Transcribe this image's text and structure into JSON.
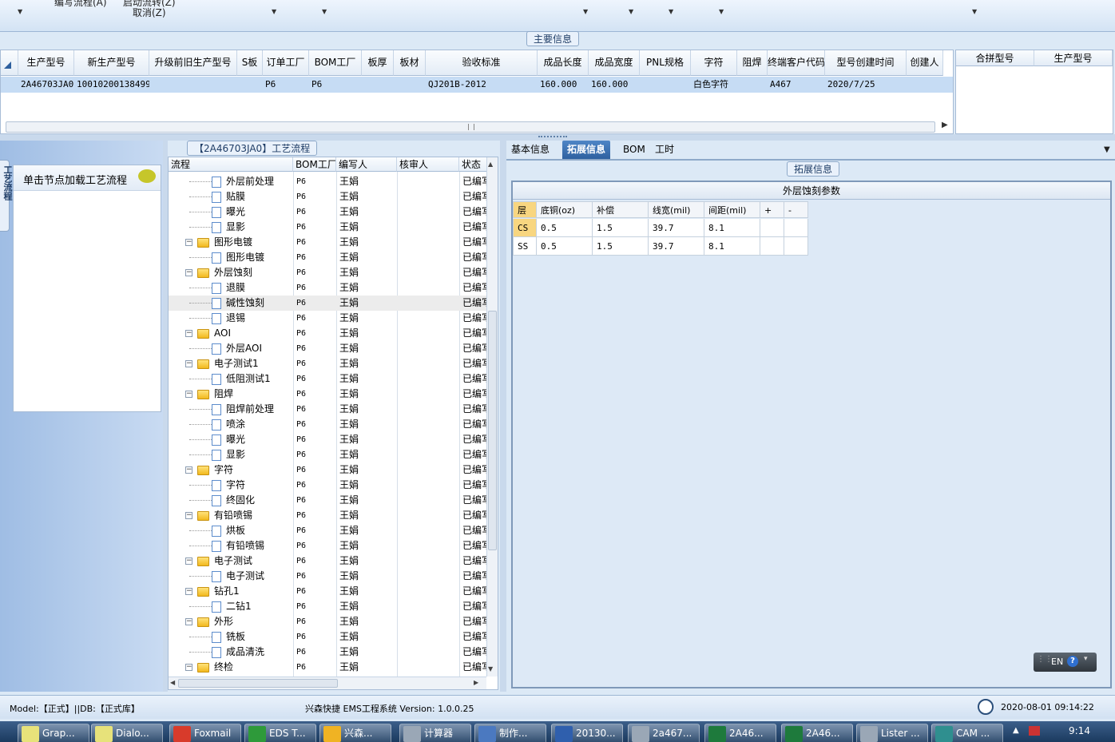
{
  "toolbar": {
    "partial1": "编写流程(A)",
    "partial2": "启动流转(Z)",
    "cancel": "取消(Z)"
  },
  "main_info": {
    "section_title": "主要信息",
    "columns": [
      "生产型号",
      "新生产型号",
      "升级前旧生产型号",
      "S板",
      "订单工厂",
      "BOM工厂",
      "板厚",
      "板材",
      "验收标准",
      "成品长度",
      "成品宽度",
      "PNL规格",
      "字符",
      "阻焊",
      "终端客户代码",
      "型号创建时间",
      "创建人"
    ],
    "row": [
      "2A46703JA0",
      "10010200138499",
      "",
      "",
      "P6",
      "P6",
      "",
      "",
      "QJ201B-2012",
      "160.000",
      "160.000",
      "",
      "白色字符",
      "",
      "A467",
      "2020/7/25",
      ""
    ]
  },
  "merge_panel": {
    "columns": [
      "合拼型号",
      "生产型号"
    ]
  },
  "left_panel": {
    "side_tab": "工艺流程",
    "node_hint": "单击节点加载工艺流程"
  },
  "process_tree": {
    "title": "【2A46703JA0】工艺流程",
    "columns": [
      "流程",
      "BOM工厂",
      "编写人",
      "核审人",
      "状态"
    ],
    "rows": [
      {
        "name": "外层前处理",
        "folder": false,
        "factory": "P6",
        "author": "王娟",
        "reviewer": "",
        "status": "已编写"
      },
      {
        "name": "贴膜",
        "folder": false,
        "factory": "P6",
        "author": "王娟",
        "reviewer": "",
        "status": "已编写"
      },
      {
        "name": "曝光",
        "folder": false,
        "factory": "P6",
        "author": "王娟",
        "reviewer": "",
        "status": "已编写"
      },
      {
        "name": "显影",
        "folder": false,
        "factory": "P6",
        "author": "王娟",
        "reviewer": "",
        "status": "已编写"
      },
      {
        "name": "图形电镀",
        "folder": true,
        "factory": "P6",
        "author": "王娟",
        "reviewer": "",
        "status": "已编写"
      },
      {
        "name": "图形电镀",
        "folder": false,
        "factory": "P6",
        "author": "王娟",
        "reviewer": "",
        "status": "已编写"
      },
      {
        "name": "外层蚀刻",
        "folder": true,
        "factory": "P6",
        "author": "王娟",
        "reviewer": "",
        "status": "已编写"
      },
      {
        "name": "退膜",
        "folder": false,
        "factory": "P6",
        "author": "王娟",
        "reviewer": "",
        "status": "已编写"
      },
      {
        "name": "碱性蚀刻",
        "folder": false,
        "factory": "P6",
        "author": "王娟",
        "reviewer": "",
        "status": "已编写",
        "selected": true
      },
      {
        "name": "退锡",
        "folder": false,
        "factory": "P6",
        "author": "王娟",
        "reviewer": "",
        "status": "已编写"
      },
      {
        "name": "AOI",
        "folder": true,
        "factory": "P6",
        "author": "王娟",
        "reviewer": "",
        "status": "已编写"
      },
      {
        "name": "外层AOI",
        "folder": false,
        "factory": "P6",
        "author": "王娟",
        "reviewer": "",
        "status": "已编写"
      },
      {
        "name": "电子测试1",
        "folder": true,
        "factory": "P6",
        "author": "王娟",
        "reviewer": "",
        "status": "已编写"
      },
      {
        "name": "低阻测试1",
        "folder": false,
        "factory": "P6",
        "author": "王娟",
        "reviewer": "",
        "status": "已编写"
      },
      {
        "name": "阻焊",
        "folder": true,
        "factory": "P6",
        "author": "王娟",
        "reviewer": "",
        "status": "已编写"
      },
      {
        "name": "阻焊前处理",
        "folder": false,
        "factory": "P6",
        "author": "王娟",
        "reviewer": "",
        "status": "已编写"
      },
      {
        "name": "喷涂",
        "folder": false,
        "factory": "P6",
        "author": "王娟",
        "reviewer": "",
        "status": "已编写"
      },
      {
        "name": "曝光",
        "folder": false,
        "factory": "P6",
        "author": "王娟",
        "reviewer": "",
        "status": "已编写"
      },
      {
        "name": "显影",
        "folder": false,
        "factory": "P6",
        "author": "王娟",
        "reviewer": "",
        "status": "已编写"
      },
      {
        "name": "字符",
        "folder": true,
        "factory": "P6",
        "author": "王娟",
        "reviewer": "",
        "status": "已编写"
      },
      {
        "name": "字符",
        "folder": false,
        "factory": "P6",
        "author": "王娟",
        "reviewer": "",
        "status": "已编写"
      },
      {
        "name": "终固化",
        "folder": false,
        "factory": "P6",
        "author": "王娟",
        "reviewer": "",
        "status": "已编写"
      },
      {
        "name": "有铅喷锡",
        "folder": true,
        "factory": "P6",
        "author": "王娟",
        "reviewer": "",
        "status": "已编写"
      },
      {
        "name": "烘板",
        "folder": false,
        "factory": "P6",
        "author": "王娟",
        "reviewer": "",
        "status": "已编写"
      },
      {
        "name": "有铅喷锡",
        "folder": false,
        "factory": "P6",
        "author": "王娟",
        "reviewer": "",
        "status": "已编写"
      },
      {
        "name": "电子测试",
        "folder": true,
        "factory": "P6",
        "author": "王娟",
        "reviewer": "",
        "status": "已编写"
      },
      {
        "name": "电子测试",
        "folder": false,
        "factory": "P6",
        "author": "王娟",
        "reviewer": "",
        "status": "已编写"
      },
      {
        "name": "钻孔1",
        "folder": true,
        "factory": "P6",
        "author": "王娟",
        "reviewer": "",
        "status": "已编写"
      },
      {
        "name": "二钻1",
        "folder": false,
        "factory": "P6",
        "author": "王娟",
        "reviewer": "",
        "status": "已编写"
      },
      {
        "name": "外形",
        "folder": true,
        "factory": "P6",
        "author": "王娟",
        "reviewer": "",
        "status": "已编写"
      },
      {
        "name": "铣板",
        "folder": false,
        "factory": "P6",
        "author": "王娟",
        "reviewer": "",
        "status": "已编写"
      },
      {
        "name": "成品清洗",
        "folder": false,
        "factory": "P6",
        "author": "王娟",
        "reviewer": "",
        "status": "已编写"
      },
      {
        "name": "终检",
        "folder": true,
        "factory": "P6",
        "author": "王娟",
        "reviewer": "",
        "status": "已编写"
      }
    ]
  },
  "detail_tabs": [
    "基本信息",
    "拓展信息",
    "BOM",
    "工时"
  ],
  "ext_info": {
    "section_title": "拓展信息",
    "table_title": "外层蚀刻参数",
    "columns": [
      "层",
      "底铜(oz)",
      "补偿",
      "线宽(mil)",
      "间距(mil)",
      "+",
      "-"
    ],
    "rows": [
      [
        "CS",
        "0.5",
        "1.5",
        "39.7",
        "8.1",
        "",
        ""
      ],
      [
        "SS",
        "0.5",
        "1.5",
        "39.7",
        "8.1",
        "",
        ""
      ]
    ]
  },
  "lang_bar": {
    "lang": "EN"
  },
  "status_bar": {
    "model": "Model:【正式】||DB:【正式库】",
    "app": "兴森快捷  EMS工程系统  Version: 1.0.0.25",
    "datetime": "2020-08-01 09:14:22"
  },
  "taskbar": {
    "items": [
      {
        "label": "Grap...",
        "color": "#e7e27a"
      },
      {
        "label": "Dialo...",
        "color": "#e7e27a"
      },
      {
        "label": "Foxmail",
        "color": "#d83b2b"
      },
      {
        "label": "EDS T...",
        "color": "#2e9a3a"
      },
      {
        "label": "兴森...",
        "color": "#f0b323"
      },
      {
        "label": "计算器",
        "color": "#9aa7b6"
      },
      {
        "label": "制作...",
        "color": "#4b79c0"
      },
      {
        "label": "20130...",
        "color": "#2f5fad"
      },
      {
        "label": "2a467...",
        "color": "#9aa7b6"
      },
      {
        "label": "2A46...",
        "color": "#1e7a3c"
      },
      {
        "label": "2A46...",
        "color": "#1e7a3c"
      },
      {
        "label": "Lister ...",
        "color": "#9aa7b6"
      },
      {
        "label": "CAM ...",
        "color": "#2f8f8f"
      }
    ],
    "time": "9:14"
  }
}
